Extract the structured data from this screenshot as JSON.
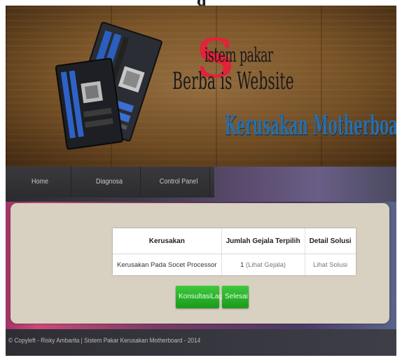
{
  "banner": {
    "line1": "istem pakar",
    "line2": "Berba   is Website",
    "big_letter": "S",
    "line3": "Kerusakan Motherboard"
  },
  "top_cutoff_title": "g",
  "nav": {
    "items": [
      {
        "label": "Home"
      },
      {
        "label": "Diagnosa"
      },
      {
        "label": "Control Panel"
      }
    ]
  },
  "results_table": {
    "headers": [
      "Kerusakan",
      "Jumlah Gejala Terpilih",
      "Detail Solusi"
    ],
    "rows": [
      {
        "kerusakan": "Kerusakan Pada Socet Processor",
        "jumlah": "1",
        "lihat_gejala": "(Lihat Gejala)",
        "detail": "Lihat Solusi"
      }
    ]
  },
  "buttons": {
    "konsultasi": "KonsultasiLagi",
    "selesai": "Selesai"
  },
  "footer": {
    "text": "© Copyleft - Risky Ambarita | Sistem Pakar Kerusakan Motherboard - 2014"
  },
  "colors": {
    "title_red": "#e0243a",
    "subtitle_blue": "#2a6ea8",
    "button_green": "#2db52d"
  }
}
